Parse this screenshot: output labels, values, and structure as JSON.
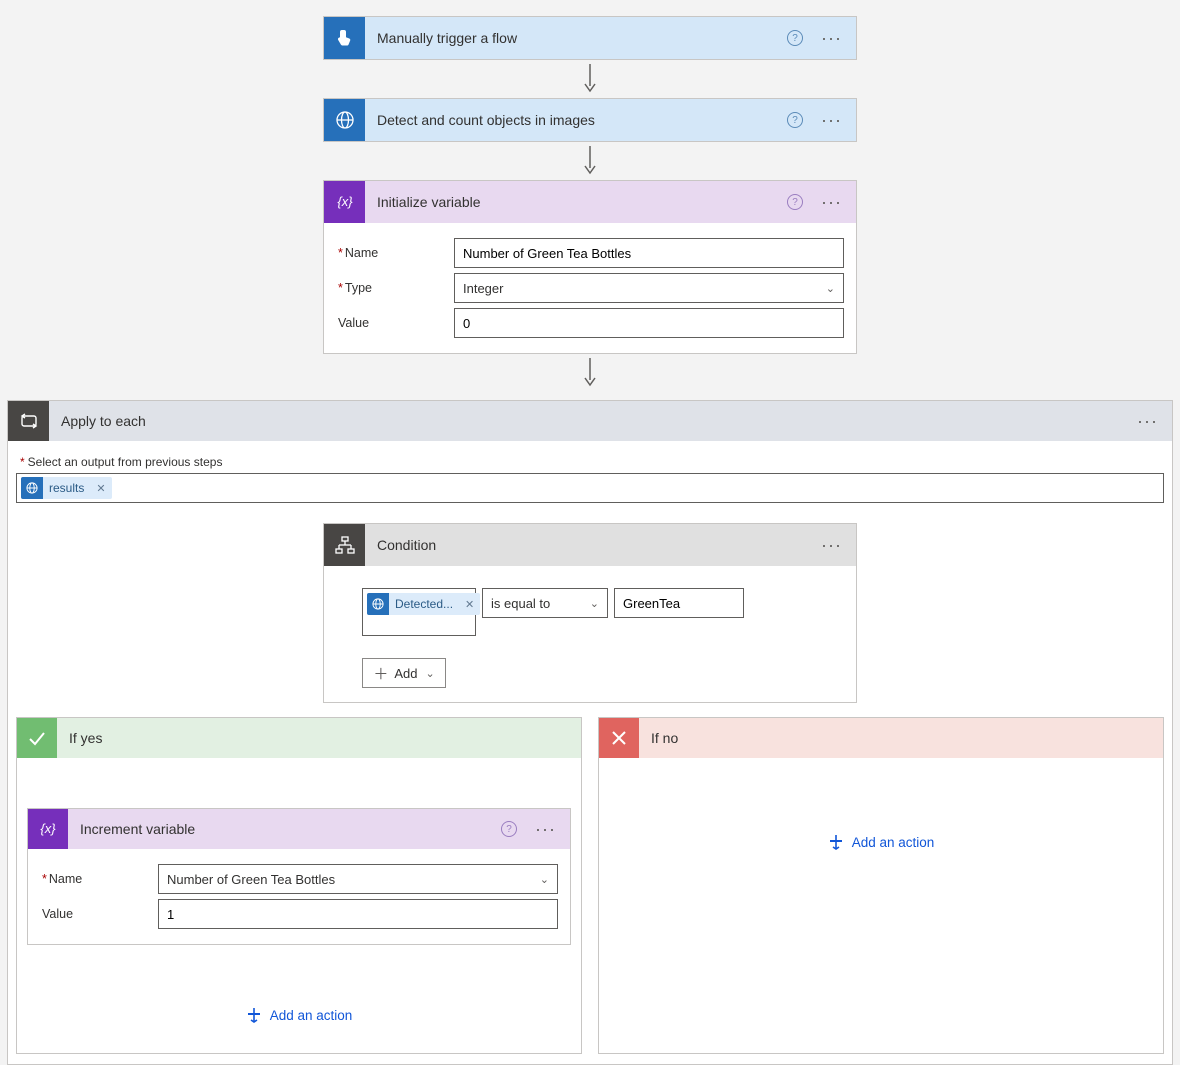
{
  "trigger": {
    "title": "Manually trigger a flow"
  },
  "ai": {
    "title": "Detect and count objects in images"
  },
  "initVar": {
    "title": "Initialize variable",
    "nameLabel": "Name",
    "nameValue": "Number of Green Tea Bottles",
    "typeLabel": "Type",
    "typeValue": "Integer",
    "valueLabel": "Value",
    "valueValue": "0"
  },
  "foreach": {
    "title": "Apply to each",
    "selectLabel": "Select an output from previous steps",
    "token": "results"
  },
  "condition": {
    "title": "Condition",
    "leftToken": "Detected...",
    "operator": "is equal to",
    "rightValue": "GreenTea",
    "addLabel": "Add"
  },
  "branches": {
    "yes": {
      "title": "If yes",
      "incrementTitle": "Increment variable",
      "nameLabel": "Name",
      "nameValue": "Number of Green Tea Bottles",
      "valueLabel": "Value",
      "valueValue": "1",
      "addAction": "Add an action"
    },
    "no": {
      "title": "If no",
      "addAction": "Add an action"
    }
  }
}
